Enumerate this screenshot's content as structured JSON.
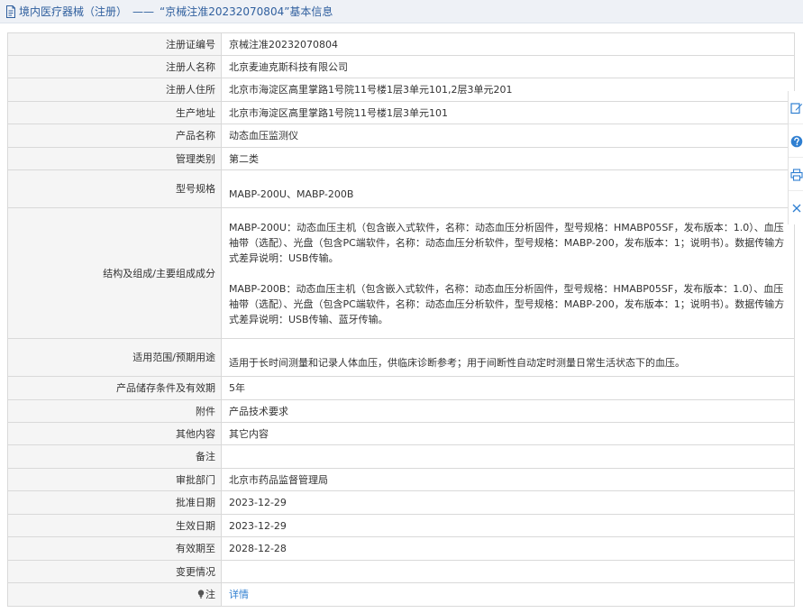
{
  "header": {
    "category": "境内医疗器械（注册）",
    "separator": "——",
    "record_title": "“京械注准20232070804”基本信息"
  },
  "rows": [
    {
      "label": "注册证编号",
      "value": "京械注准20232070804"
    },
    {
      "label": "注册人名称",
      "value": "北京麦迪克斯科技有限公司"
    },
    {
      "label": "注册人住所",
      "value": "北京市海淀区高里掌路1号院11号楼1层3单元101,2层3单元201"
    },
    {
      "label": "生产地址",
      "value": "北京市海淀区高里掌路1号院11号楼1层3单元101"
    },
    {
      "label": "产品名称",
      "value": "动态血压监测仪"
    },
    {
      "label": "管理类别",
      "value": "第二类"
    },
    {
      "label": "型号规格",
      "value": "MABP-200U、MABP-200B"
    },
    {
      "label": "结构及组成/主要组成成分",
      "paragraphs": [
        "MABP-200U：动态血压主机（包含嵌入式软件，名称：动态血压分析固件，型号规格：HMABP05SF，发布版本：1.0）、血压袖带（选配）、光盘（包含PC端软件，名称：动态血压分析软件，型号规格：MABP-200，发布版本：1；说明书）。数据传输方式差异说明：USB传输。",
        "MABP-200B：动态血压主机（包含嵌入式软件，名称：动态血压分析固件，型号规格：HMABP05SF，发布版本：1.0）、血压袖带（选配）、光盘（包含PC端软件，名称：动态血压分析软件，型号规格：MABP-200，发布版本：1；说明书）。数据传输方式差异说明：USB传输、蓝牙传输。"
      ]
    },
    {
      "label": "适用范围/预期用途",
      "value": "适用于长时间测量和记录人体血压，供临床诊断参考；用于间断性自动定时测量日常生活状态下的血压。"
    },
    {
      "label": "产品储存条件及有效期",
      "value": "5年"
    },
    {
      "label": "附件",
      "value": "产品技术要求"
    },
    {
      "label": "其他内容",
      "value": "其它内容"
    },
    {
      "label": "备注",
      "value": ""
    },
    {
      "label": "审批部门",
      "value": "北京市药品监督管理局"
    },
    {
      "label": "批准日期",
      "value": "2023-12-29"
    },
    {
      "label": "生效日期",
      "value": "2023-12-29"
    },
    {
      "label": "有效期至",
      "value": "2028-12-28"
    },
    {
      "label": "变更情况",
      "value": ""
    },
    {
      "label": "注",
      "value": "详情"
    }
  ],
  "colors": {
    "header_bg": "#eef1f6",
    "header_text": "#2f5f9e",
    "label_bg": "#f5f5f5",
    "border": "#d9d9d9",
    "link": "#2f7fd1",
    "toolbar_icon": "#2f7fd1"
  },
  "icons": {
    "header": "document-icon",
    "note": "lightbulb-icon",
    "toolbar": [
      "edit-icon",
      "help-icon",
      "print-icon",
      "close-icon"
    ]
  }
}
